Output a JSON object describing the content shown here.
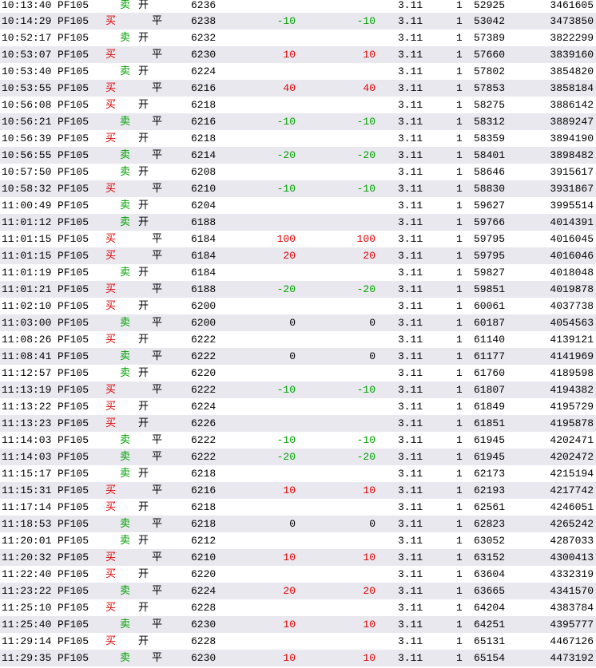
{
  "colors": {
    "buy": "#e00000",
    "sell": "#00a000",
    "row_alt": "#e8e8ee"
  },
  "rows": [
    {
      "time": "10:13:40",
      "code": "PF105",
      "dir": "卖",
      "dir_type": "sell",
      "kind": "开",
      "kind_type": "open",
      "price": "6236",
      "chg1": "",
      "chg2": "",
      "v1": "3.11",
      "v2": "1",
      "n1": "52925",
      "n2": "3461605"
    },
    {
      "time": "10:14:29",
      "code": "PF105",
      "dir": "买",
      "dir_type": "buy",
      "kind": "平",
      "kind_type": "close",
      "price": "6238",
      "chg1": "-10",
      "chg2": "-10",
      "v1": "3.11",
      "v2": "1",
      "n1": "53042",
      "n2": "3473850"
    },
    {
      "time": "10:52:17",
      "code": "PF105",
      "dir": "卖",
      "dir_type": "sell",
      "kind": "开",
      "kind_type": "open",
      "price": "6232",
      "chg1": "",
      "chg2": "",
      "v1": "3.11",
      "v2": "1",
      "n1": "57389",
      "n2": "3822299"
    },
    {
      "time": "10:53:07",
      "code": "PF105",
      "dir": "买",
      "dir_type": "buy",
      "kind": "平",
      "kind_type": "close",
      "price": "6230",
      "chg1": "10",
      "chg2": "10",
      "v1": "3.11",
      "v2": "1",
      "n1": "57660",
      "n2": "3839160"
    },
    {
      "time": "10:53:40",
      "code": "PF105",
      "dir": "卖",
      "dir_type": "sell",
      "kind": "开",
      "kind_type": "open",
      "price": "6224",
      "chg1": "",
      "chg2": "",
      "v1": "3.11",
      "v2": "1",
      "n1": "57802",
      "n2": "3854820"
    },
    {
      "time": "10:53:55",
      "code": "PF105",
      "dir": "买",
      "dir_type": "buy",
      "kind": "平",
      "kind_type": "close",
      "price": "6216",
      "chg1": "40",
      "chg2": "40",
      "v1": "3.11",
      "v2": "1",
      "n1": "57853",
      "n2": "3858184"
    },
    {
      "time": "10:56:08",
      "code": "PF105",
      "dir": "买",
      "dir_type": "buy",
      "kind": "开",
      "kind_type": "open",
      "price": "6218",
      "chg1": "",
      "chg2": "",
      "v1": "3.11",
      "v2": "1",
      "n1": "58275",
      "n2": "3886142"
    },
    {
      "time": "10:56:21",
      "code": "PF105",
      "dir": "卖",
      "dir_type": "sell",
      "kind": "平",
      "kind_type": "close",
      "price": "6216",
      "chg1": "-10",
      "chg2": "-10",
      "v1": "3.11",
      "v2": "1",
      "n1": "58312",
      "n2": "3889247"
    },
    {
      "time": "10:56:39",
      "code": "PF105",
      "dir": "买",
      "dir_type": "buy",
      "kind": "开",
      "kind_type": "open",
      "price": "6218",
      "chg1": "",
      "chg2": "",
      "v1": "3.11",
      "v2": "1",
      "n1": "58359",
      "n2": "3894190"
    },
    {
      "time": "10:56:55",
      "code": "PF105",
      "dir": "卖",
      "dir_type": "sell",
      "kind": "平",
      "kind_type": "close",
      "price": "6214",
      "chg1": "-20",
      "chg2": "-20",
      "v1": "3.11",
      "v2": "1",
      "n1": "58401",
      "n2": "3898482"
    },
    {
      "time": "10:57:50",
      "code": "PF105",
      "dir": "卖",
      "dir_type": "sell",
      "kind": "开",
      "kind_type": "open",
      "price": "6208",
      "chg1": "",
      "chg2": "",
      "v1": "3.11",
      "v2": "1",
      "n1": "58646",
      "n2": "3915617"
    },
    {
      "time": "10:58:32",
      "code": "PF105",
      "dir": "买",
      "dir_type": "buy",
      "kind": "平",
      "kind_type": "close",
      "price": "6210",
      "chg1": "-10",
      "chg2": "-10",
      "v1": "3.11",
      "v2": "1",
      "n1": "58830",
      "n2": "3931867"
    },
    {
      "time": "11:00:49",
      "code": "PF105",
      "dir": "卖",
      "dir_type": "sell",
      "kind": "开",
      "kind_type": "open",
      "price": "6204",
      "chg1": "",
      "chg2": "",
      "v1": "3.11",
      "v2": "1",
      "n1": "59627",
      "n2": "3995514"
    },
    {
      "time": "11:01:12",
      "code": "PF105",
      "dir": "卖",
      "dir_type": "sell",
      "kind": "开",
      "kind_type": "open",
      "price": "6188",
      "chg1": "",
      "chg2": "",
      "v1": "3.11",
      "v2": "1",
      "n1": "59766",
      "n2": "4014391"
    },
    {
      "time": "11:01:15",
      "code": "PF105",
      "dir": "买",
      "dir_type": "buy",
      "kind": "平",
      "kind_type": "close",
      "price": "6184",
      "chg1": "100",
      "chg2": "100",
      "v1": "3.11",
      "v2": "1",
      "n1": "59795",
      "n2": "4016045"
    },
    {
      "time": "11:01:15",
      "code": "PF105",
      "dir": "买",
      "dir_type": "buy",
      "kind": "平",
      "kind_type": "close",
      "price": "6184",
      "chg1": "20",
      "chg2": "20",
      "v1": "3.11",
      "v2": "1",
      "n1": "59795",
      "n2": "4016046"
    },
    {
      "time": "11:01:19",
      "code": "PF105",
      "dir": "卖",
      "dir_type": "sell",
      "kind": "开",
      "kind_type": "open",
      "price": "6184",
      "chg1": "",
      "chg2": "",
      "v1": "3.11",
      "v2": "1",
      "n1": "59827",
      "n2": "4018048"
    },
    {
      "time": "11:01:21",
      "code": "PF105",
      "dir": "买",
      "dir_type": "buy",
      "kind": "平",
      "kind_type": "close",
      "price": "6188",
      "chg1": "-20",
      "chg2": "-20",
      "v1": "3.11",
      "v2": "1",
      "n1": "59851",
      "n2": "4019878"
    },
    {
      "time": "11:02:10",
      "code": "PF105",
      "dir": "买",
      "dir_type": "buy",
      "kind": "开",
      "kind_type": "open",
      "price": "6200",
      "chg1": "",
      "chg2": "",
      "v1": "3.11",
      "v2": "1",
      "n1": "60061",
      "n2": "4037738"
    },
    {
      "time": "11:03:00",
      "code": "PF105",
      "dir": "卖",
      "dir_type": "sell",
      "kind": "平",
      "kind_type": "close",
      "price": "6200",
      "chg1": "0",
      "chg2": "0",
      "v1": "3.11",
      "v2": "1",
      "n1": "60187",
      "n2": "4054563"
    },
    {
      "time": "11:08:26",
      "code": "PF105",
      "dir": "买",
      "dir_type": "buy",
      "kind": "开",
      "kind_type": "open",
      "price": "6222",
      "chg1": "",
      "chg2": "",
      "v1": "3.11",
      "v2": "1",
      "n1": "61140",
      "n2": "4139121"
    },
    {
      "time": "11:08:41",
      "code": "PF105",
      "dir": "卖",
      "dir_type": "sell",
      "kind": "平",
      "kind_type": "close",
      "price": "6222",
      "chg1": "0",
      "chg2": "0",
      "v1": "3.11",
      "v2": "1",
      "n1": "61177",
      "n2": "4141969"
    },
    {
      "time": "11:12:57",
      "code": "PF105",
      "dir": "卖",
      "dir_type": "sell",
      "kind": "开",
      "kind_type": "open",
      "price": "6220",
      "chg1": "",
      "chg2": "",
      "v1": "3.11",
      "v2": "1",
      "n1": "61760",
      "n2": "4189598"
    },
    {
      "time": "11:13:19",
      "code": "PF105",
      "dir": "买",
      "dir_type": "buy",
      "kind": "平",
      "kind_type": "close",
      "price": "6222",
      "chg1": "-10",
      "chg2": "-10",
      "v1": "3.11",
      "v2": "1",
      "n1": "61807",
      "n2": "4194382"
    },
    {
      "time": "11:13:22",
      "code": "PF105",
      "dir": "买",
      "dir_type": "buy",
      "kind": "开",
      "kind_type": "open",
      "price": "6224",
      "chg1": "",
      "chg2": "",
      "v1": "3.11",
      "v2": "1",
      "n1": "61849",
      "n2": "4195729"
    },
    {
      "time": "11:13:23",
      "code": "PF105",
      "dir": "买",
      "dir_type": "buy",
      "kind": "开",
      "kind_type": "open",
      "price": "6226",
      "chg1": "",
      "chg2": "",
      "v1": "3.11",
      "v2": "1",
      "n1": "61851",
      "n2": "4195878"
    },
    {
      "time": "11:14:03",
      "code": "PF105",
      "dir": "卖",
      "dir_type": "sell",
      "kind": "平",
      "kind_type": "close",
      "price": "6222",
      "chg1": "-10",
      "chg2": "-10",
      "v1": "3.11",
      "v2": "1",
      "n1": "61945",
      "n2": "4202471"
    },
    {
      "time": "11:14:03",
      "code": "PF105",
      "dir": "卖",
      "dir_type": "sell",
      "kind": "平",
      "kind_type": "close",
      "price": "6222",
      "chg1": "-20",
      "chg2": "-20",
      "v1": "3.11",
      "v2": "1",
      "n1": "61945",
      "n2": "4202472"
    },
    {
      "time": "11:15:17",
      "code": "PF105",
      "dir": "卖",
      "dir_type": "sell",
      "kind": "开",
      "kind_type": "open",
      "price": "6218",
      "chg1": "",
      "chg2": "",
      "v1": "3.11",
      "v2": "1",
      "n1": "62173",
      "n2": "4215194"
    },
    {
      "time": "11:15:31",
      "code": "PF105",
      "dir": "买",
      "dir_type": "buy",
      "kind": "平",
      "kind_type": "close",
      "price": "6216",
      "chg1": "10",
      "chg2": "10",
      "v1": "3.11",
      "v2": "1",
      "n1": "62193",
      "n2": "4217742"
    },
    {
      "time": "11:17:14",
      "code": "PF105",
      "dir": "买",
      "dir_type": "buy",
      "kind": "开",
      "kind_type": "open",
      "price": "6218",
      "chg1": "",
      "chg2": "",
      "v1": "3.11",
      "v2": "1",
      "n1": "62561",
      "n2": "4246051"
    },
    {
      "time": "11:18:53",
      "code": "PF105",
      "dir": "卖",
      "dir_type": "sell",
      "kind": "平",
      "kind_type": "close",
      "price": "6218",
      "chg1": "0",
      "chg2": "0",
      "v1": "3.11",
      "v2": "1",
      "n1": "62823",
      "n2": "4265242"
    },
    {
      "time": "11:20:01",
      "code": "PF105",
      "dir": "卖",
      "dir_type": "sell",
      "kind": "开",
      "kind_type": "open",
      "price": "6212",
      "chg1": "",
      "chg2": "",
      "v1": "3.11",
      "v2": "1",
      "n1": "63052",
      "n2": "4287033"
    },
    {
      "time": "11:20:32",
      "code": "PF105",
      "dir": "买",
      "dir_type": "buy",
      "kind": "平",
      "kind_type": "close",
      "price": "6210",
      "chg1": "10",
      "chg2": "10",
      "v1": "3.11",
      "v2": "1",
      "n1": "63152",
      "n2": "4300413"
    },
    {
      "time": "11:22:40",
      "code": "PF105",
      "dir": "买",
      "dir_type": "buy",
      "kind": "开",
      "kind_type": "open",
      "price": "6220",
      "chg1": "",
      "chg2": "",
      "v1": "3.11",
      "v2": "1",
      "n1": "63604",
      "n2": "4332319"
    },
    {
      "time": "11:23:22",
      "code": "PF105",
      "dir": "卖",
      "dir_type": "sell",
      "kind": "平",
      "kind_type": "close",
      "price": "6224",
      "chg1": "20",
      "chg2": "20",
      "v1": "3.11",
      "v2": "1",
      "n1": "63665",
      "n2": "4341570"
    },
    {
      "time": "11:25:10",
      "code": "PF105",
      "dir": "买",
      "dir_type": "buy",
      "kind": "开",
      "kind_type": "open",
      "price": "6228",
      "chg1": "",
      "chg2": "",
      "v1": "3.11",
      "v2": "1",
      "n1": "64204",
      "n2": "4383784"
    },
    {
      "time": "11:25:40",
      "code": "PF105",
      "dir": "卖",
      "dir_type": "sell",
      "kind": "平",
      "kind_type": "close",
      "price": "6230",
      "chg1": "10",
      "chg2": "10",
      "v1": "3.11",
      "v2": "1",
      "n1": "64251",
      "n2": "4395777"
    },
    {
      "time": "11:29:14",
      "code": "PF105",
      "dir": "买",
      "dir_type": "buy",
      "kind": "开",
      "kind_type": "open",
      "price": "6228",
      "chg1": "",
      "chg2": "",
      "v1": "3.11",
      "v2": "1",
      "n1": "65131",
      "n2": "4467126"
    },
    {
      "time": "11:29:35",
      "code": "PF105",
      "dir": "卖",
      "dir_type": "sell",
      "kind": "平",
      "kind_type": "close",
      "price": "6230",
      "chg1": "10",
      "chg2": "10",
      "v1": "3.11",
      "v2": "1",
      "n1": "65154",
      "n2": "4473192"
    }
  ]
}
